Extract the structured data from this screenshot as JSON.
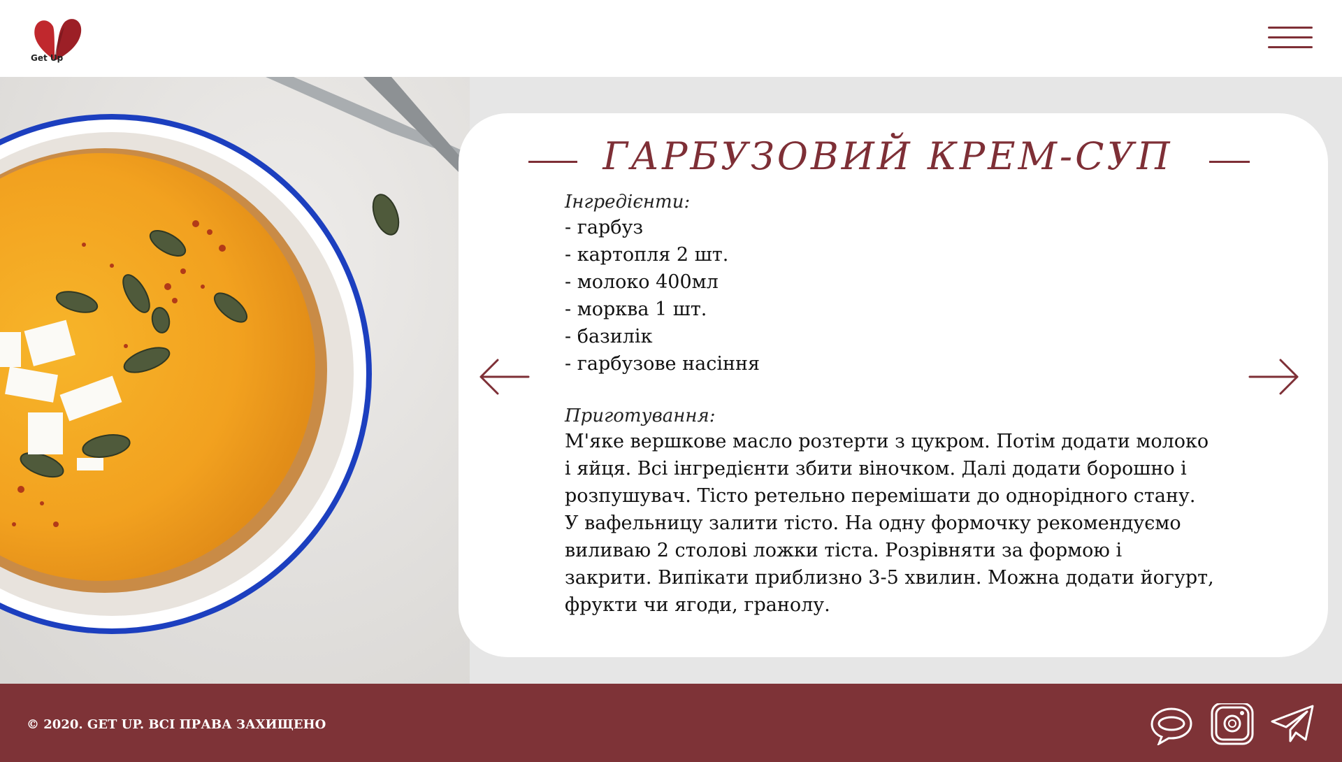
{
  "header": {
    "logo_text": "Get Up",
    "menu_label": "menu"
  },
  "recipe": {
    "title": "Гарбузовий крем-суп",
    "ingredients_label": "Інгредієнти:",
    "ingredients": [
      "- гарбуз",
      "- картопля 2 шт.",
      "- молоко 400мл",
      "- морква 1 шт.",
      "- базилік",
      "- гарбузове насіння"
    ],
    "method_label": "Приготування:",
    "method": [
      "М'яке вершкове масло розтерти з цукром. Потім додати молоко і яйця. Всі інгредієнти збити віночком. Далі додати борошно і розпушувач. Тісто ретельно перемішати до однорідного стану.",
      "У вафельницу залити тісто. На одну формочку рекомендуємо виливаю 2 столові ложки тіста. Розрівняти за формою і закрити. Випікати приблизно 3-5 хвилин. Можна додати йогурт, фрукти чи ягоди, гранолу."
    ]
  },
  "footer": {
    "copyright": "© 2020. GET UP. ВСІ ПРАВА ЗАХИЩЕНО",
    "social": [
      "chat-icon",
      "instagram-icon",
      "telegram-icon"
    ]
  },
  "colors": {
    "brand": "#7e2f36",
    "footer_bg": "#7e3337",
    "page_bg": "#e6e6e6",
    "soup": "#f5a623"
  }
}
